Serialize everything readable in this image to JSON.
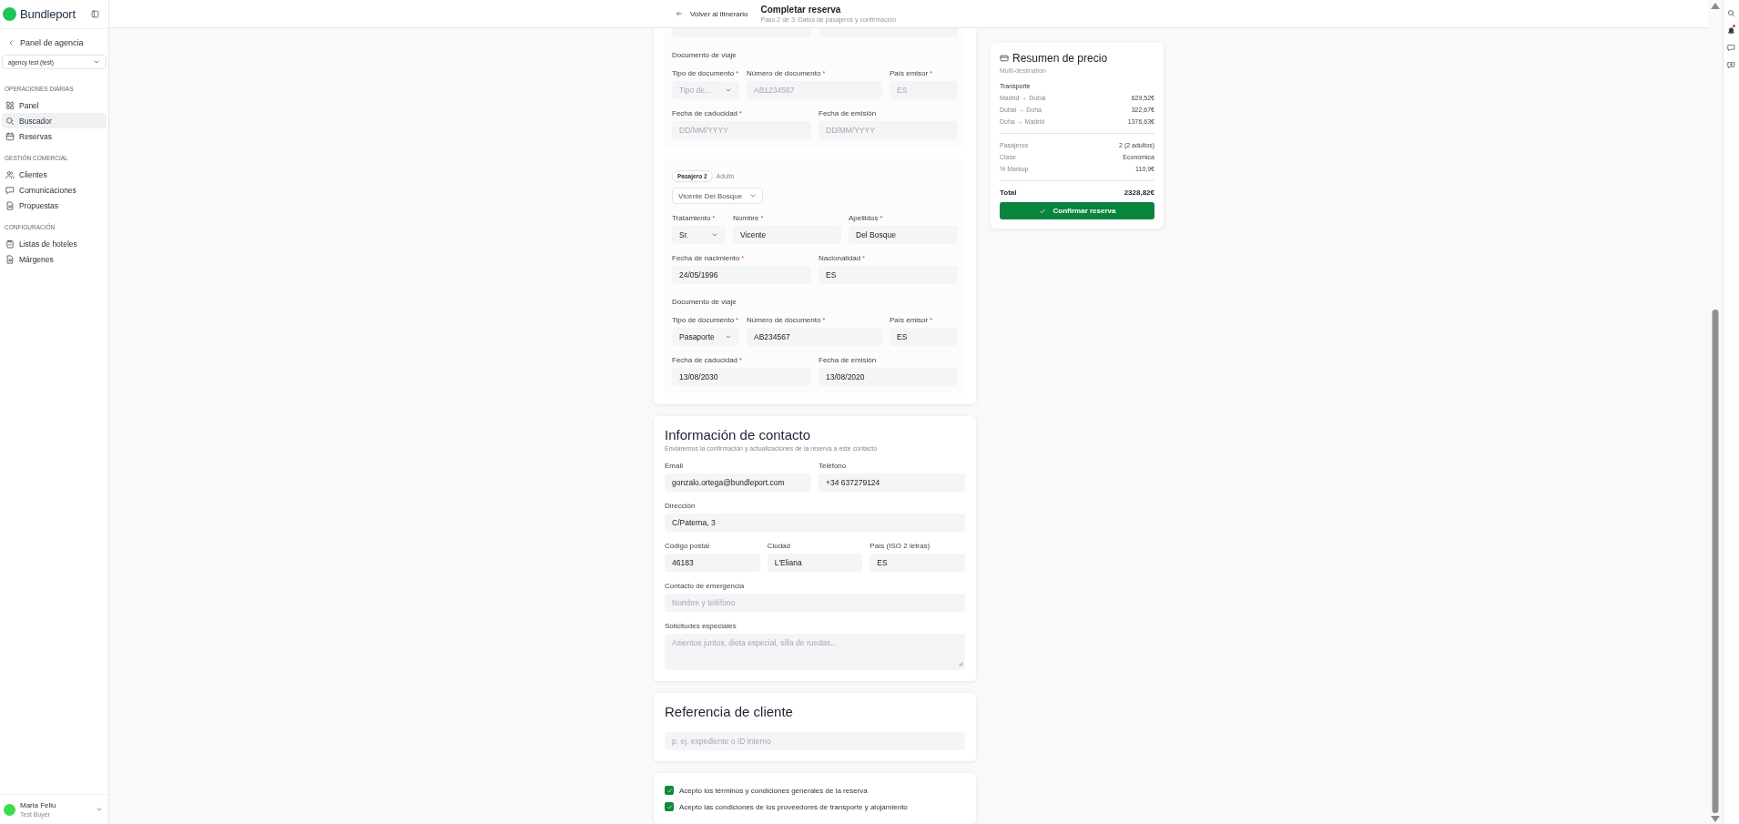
{
  "sidebar": {
    "logo": "Bundleport",
    "back": "Panel de agencia",
    "agency_select": "agency test (test)",
    "sections": [
      {
        "title": "OPERACIONES DIARIAS",
        "items": [
          {
            "label": "Panel",
            "selected": false
          },
          {
            "label": "Buscador",
            "selected": true
          },
          {
            "label": "Reservas",
            "selected": false
          }
        ]
      },
      {
        "title": "GESTIÓN COMERCIAL",
        "items": [
          {
            "label": "Clientes",
            "selected": false
          },
          {
            "label": "Comunicaciones",
            "selected": false
          },
          {
            "label": "Propuestas",
            "selected": false
          }
        ]
      },
      {
        "title": "CONFIGURACIÓN",
        "items": [
          {
            "label": "Listas de hoteles",
            "selected": false
          },
          {
            "label": "Márgenes",
            "selected": false
          }
        ]
      }
    ],
    "user": {
      "name": "Maria Feliu",
      "role": "Test Buyer"
    }
  },
  "header": {
    "back": "Volver al itinerario",
    "title": "Completar reserva",
    "subtitle": "Paso 2 de 3: Datos de pasajeros y confirmación"
  },
  "passengers": [
    {
      "groups": [
        {
          "heading": "Documento de viaje",
          "rows": [
            {
              "kind": "document",
              "fields": [
                {
                  "label": "Tipo de documento",
                  "mark": "*",
                  "kind": "select",
                  "placeholder": "Tipo de..."
                },
                {
                  "label": "Número de documento",
                  "mark": "*",
                  "kind": "text",
                  "placeholder": "AB1234567"
                },
                {
                  "label": "País emisor",
                  "mark": "*",
                  "kind": "text",
                  "placeholder": "ES"
                }
              ]
            },
            {
              "kind": "pair",
              "fields": [
                {
                  "label": "Fecha de caducidad",
                  "mark": "*",
                  "kind": "text",
                  "placeholder": "DD/MM/YYYY"
                },
                {
                  "label": "Fecha de emisión",
                  "kind": "text",
                  "placeholder": "DD/MM/YYYY"
                }
              ]
            }
          ]
        }
      ]
    },
    {
      "badge": "Pasajero 2",
      "type": "Adulto",
      "traveler": "Vicente Del Bosque",
      "groups": [
        {
          "rows": [
            {
              "kind": "name",
              "fields": [
                {
                  "label": "Tratamiento",
                  "mark": "*",
                  "kind": "select",
                  "value": "Sr."
                },
                {
                  "label": "Nombre",
                  "mark": "*",
                  "kind": "text",
                  "value": "Vicente"
                },
                {
                  "label": "Apellidos",
                  "mark": "*",
                  "kind": "text",
                  "value": "Del Bosque"
                }
              ]
            },
            {
              "kind": "pair",
              "fields": [
                {
                  "label": "Fecha de nacimiento",
                  "mark": "*",
                  "kind": "text",
                  "value": "24/05/1996"
                },
                {
                  "label": "Nacionalidad",
                  "mark": "*",
                  "kind": "text",
                  "value": "ES"
                }
              ]
            }
          ]
        },
        {
          "heading": "Documento de viaje",
          "rows": [
            {
              "kind": "document",
              "fields": [
                {
                  "label": "Tipo de documento",
                  "mark": "*",
                  "kind": "select",
                  "value": "Pasaporte"
                },
                {
                  "label": "Número de documento",
                  "mark": "*",
                  "kind": "text",
                  "value": "AB234567"
                },
                {
                  "label": "País emisor",
                  "mark": "*",
                  "kind": "text",
                  "value": "ES"
                }
              ]
            },
            {
              "kind": "pair",
              "fields": [
                {
                  "label": "Fecha de caducidad",
                  "mark": "*",
                  "kind": "text",
                  "value": "13/08/2030"
                },
                {
                  "label": "Fecha de emisión",
                  "kind": "text",
                  "value": "13/08/2020"
                }
              ]
            }
          ]
        }
      ]
    }
  ],
  "contact": {
    "title": "Información de contacto",
    "subtitle": "Enviaremos la confirmación y actualizaciones de la reserva a este contacto",
    "rows": [
      {
        "kind": "pair",
        "fields": [
          {
            "label": "Email",
            "kind": "text",
            "value": "gonzalo.ortega@bundleport.com"
          },
          {
            "label": "Teléfono",
            "kind": "text",
            "value": "+34 637279124"
          }
        ]
      },
      {
        "kind": "single",
        "fields": [
          {
            "label": "Dirección",
            "kind": "text",
            "value": "C/Paterna, 3"
          }
        ]
      },
      {
        "kind": "triple",
        "fields": [
          {
            "label": "Código postal",
            "kind": "text",
            "value": "46183"
          },
          {
            "label": "Ciudad",
            "kind": "text",
            "value": "L'Eliana"
          },
          {
            "label": "País (ISO 2 letras)",
            "kind": "text",
            "value": "ES"
          }
        ]
      },
      {
        "kind": "single",
        "fields": [
          {
            "label": "Contacto de emergencia",
            "kind": "text",
            "placeholder": "Nombre y teléfono"
          }
        ]
      },
      {
        "kind": "single",
        "fields": [
          {
            "label": "Solicitudes especiales",
            "kind": "textarea",
            "placeholder": "Asientos juntos, dieta especial, silla de ruedas..."
          }
        ]
      }
    ]
  },
  "reference": {
    "title": "Referencia de cliente",
    "rows": [
      {
        "kind": "single",
        "fields": [
          {
            "kind": "text",
            "placeholder": "p. ej. expediente o ID interno"
          }
        ]
      }
    ]
  },
  "agreements": [
    {
      "label": "Acepto los términos y condiciones generales de la reserva",
      "checked": true
    },
    {
      "label": "Acepto las condiciones de los proveedores de transporte y alojamiento",
      "checked": true
    }
  ],
  "price": {
    "title": "Resumen de precio",
    "subtitle": "Multi-destination",
    "section": "Transporte",
    "routes": [
      {
        "label": "Madrid → Dubai",
        "amount": "629,52€"
      },
      {
        "label": "Dubai → Doha",
        "amount": "322,67€"
      },
      {
        "label": "Doha → Madrid",
        "amount": "1376,63€"
      }
    ],
    "details": [
      {
        "label": "Pasajeros",
        "value": "2 (2 adultos)"
      },
      {
        "label": "Clase",
        "value": "Económica"
      },
      {
        "label": "% Markup",
        "value": "110,9€"
      }
    ],
    "total": {
      "label": "Total",
      "value": "2328,82€"
    },
    "button": "Confirmar reserva"
  }
}
